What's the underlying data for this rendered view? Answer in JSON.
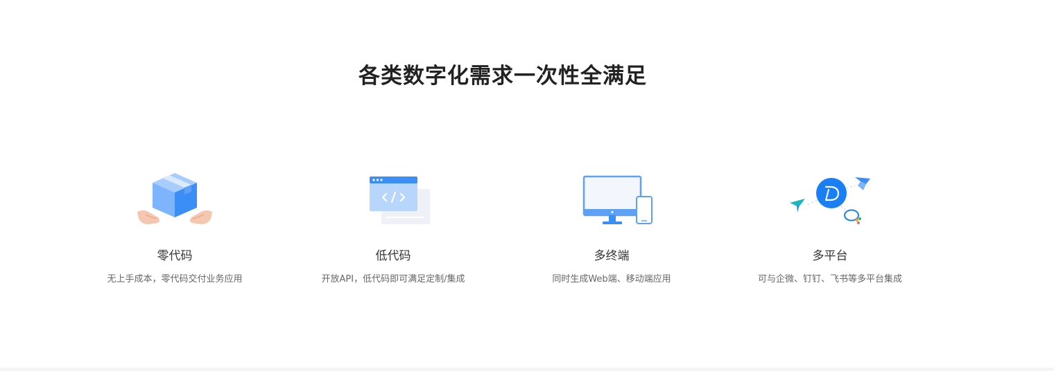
{
  "section": {
    "title": "各类数字化需求一次性全满足"
  },
  "features": [
    {
      "name": "零代码",
      "desc": "无上手成本，零代码交付业务应用",
      "icon": "box-in-hands-icon"
    },
    {
      "name": "低代码",
      "desc": "开放API，低代码即可满足定制/集成",
      "icon": "code-window-icon"
    },
    {
      "name": "多终端",
      "desc": "同时生成Web端、移动端应用",
      "icon": "devices-icon"
    },
    {
      "name": "多平台",
      "desc": "可与企微、钉钉、飞书等多平台集成",
      "icon": "platforms-icon"
    }
  ],
  "colors": {
    "primary_blue": "#3a8ef6",
    "light_blue": "#7db4fb",
    "title_text": "#222222",
    "name_text": "#333333",
    "desc_text": "#666666"
  }
}
